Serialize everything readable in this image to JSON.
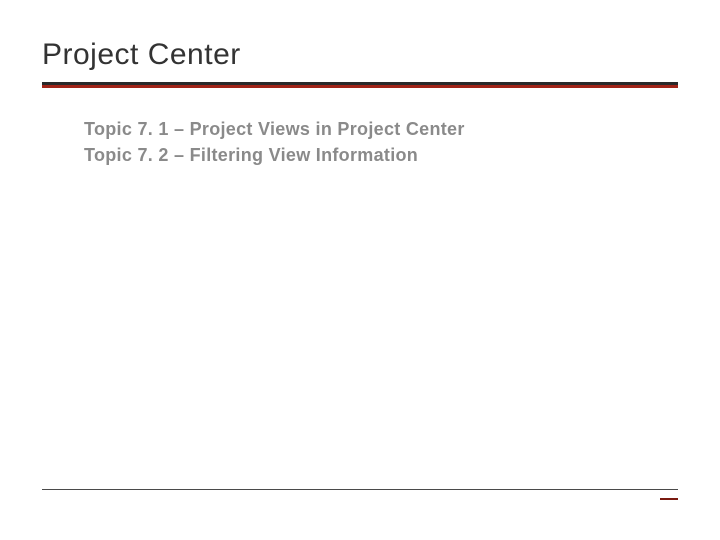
{
  "title": "Project Center",
  "topics": [
    {
      "label": "Topic 7. 1 – Project Views in Project Center"
    },
    {
      "label": "Topic 7. 2 – Filtering View Information"
    }
  ],
  "colors": {
    "accent": "#a02418",
    "text_muted": "#8a8a8a",
    "rule_dark": "#2a2a2a"
  }
}
